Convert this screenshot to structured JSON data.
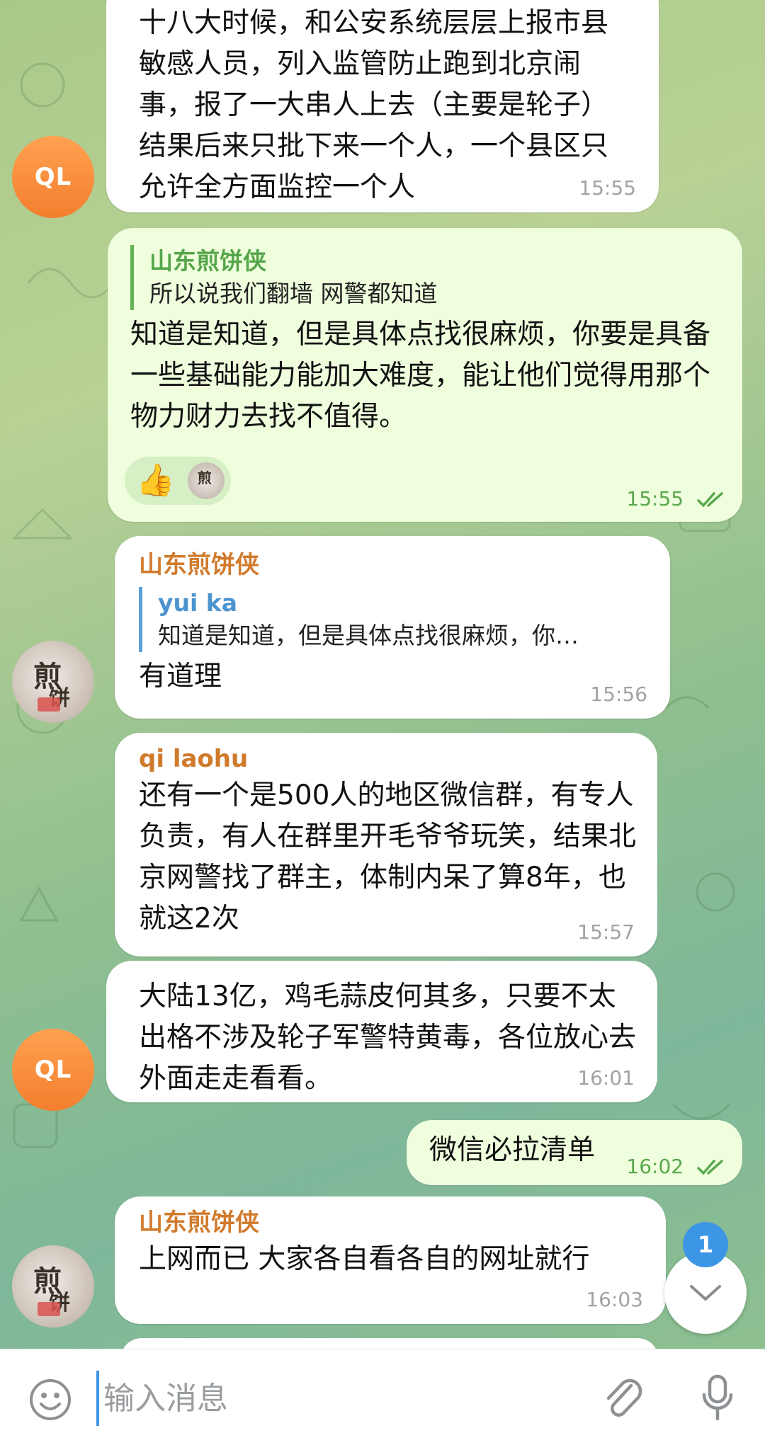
{
  "messages": [
    {
      "id": "m1",
      "text": "十八大时候，和公安系统层层上报市县敏感人员，列入监管防止跑到北京闹事，报了一大串人上去（主要是轮子）结果后来只批下来一个人，一个县区只允许全方面监控一个人",
      "time": "15:55",
      "avatar_initials": "QL"
    },
    {
      "id": "m2",
      "reply_name": "山东煎饼侠",
      "reply_text": "所以说我们翻墙 网警都知道",
      "text": "知道是知道，但是具体点找很麻烦，你要是具备一些基础能力能加大难度，能让他们觉得用那个物力财力去找不值得。",
      "reaction_emoji": "👍",
      "time": "15:55"
    },
    {
      "id": "m3",
      "sender": "山东煎饼侠",
      "reply_name": "yui ka",
      "reply_text": "知道是知道，但是具体点找很麻烦，你…",
      "text": "有道理",
      "time": "15:56"
    },
    {
      "id": "m4",
      "sender": "qi laohu",
      "text": "还有一个是500人的地区微信群，有专人负责，有人在群里开毛爷爷玩笑，结果北京网警找了群主，体制内呆了算8年，也就这2次",
      "time": "15:57"
    },
    {
      "id": "m5",
      "text": "大陆13亿，鸡毛蒜皮何其多，只要不太出格不涉及轮子军警特黄毒，各位放心去外面走走看看。",
      "time": "16:01",
      "avatar_initials": "QL"
    },
    {
      "id": "m6",
      "text": "微信必拉清单",
      "time": "16:02"
    },
    {
      "id": "m7",
      "sender": "山东煎饼侠",
      "text": "上网而已 大家各自看各自的网址就行",
      "time": "16:03"
    }
  ],
  "avatar_jianbing": {
    "char1": "煎",
    "char2": "饼"
  },
  "scroll_badge": "1",
  "composer": {
    "placeholder": "输入消息"
  },
  "colors": {
    "sender_orange": "#d07a2c",
    "sender_green": "#55a64a",
    "reply_blue": "#4d94cf",
    "outgoing_bubble": "#effedd",
    "accent_blue": "#3d95e6"
  }
}
